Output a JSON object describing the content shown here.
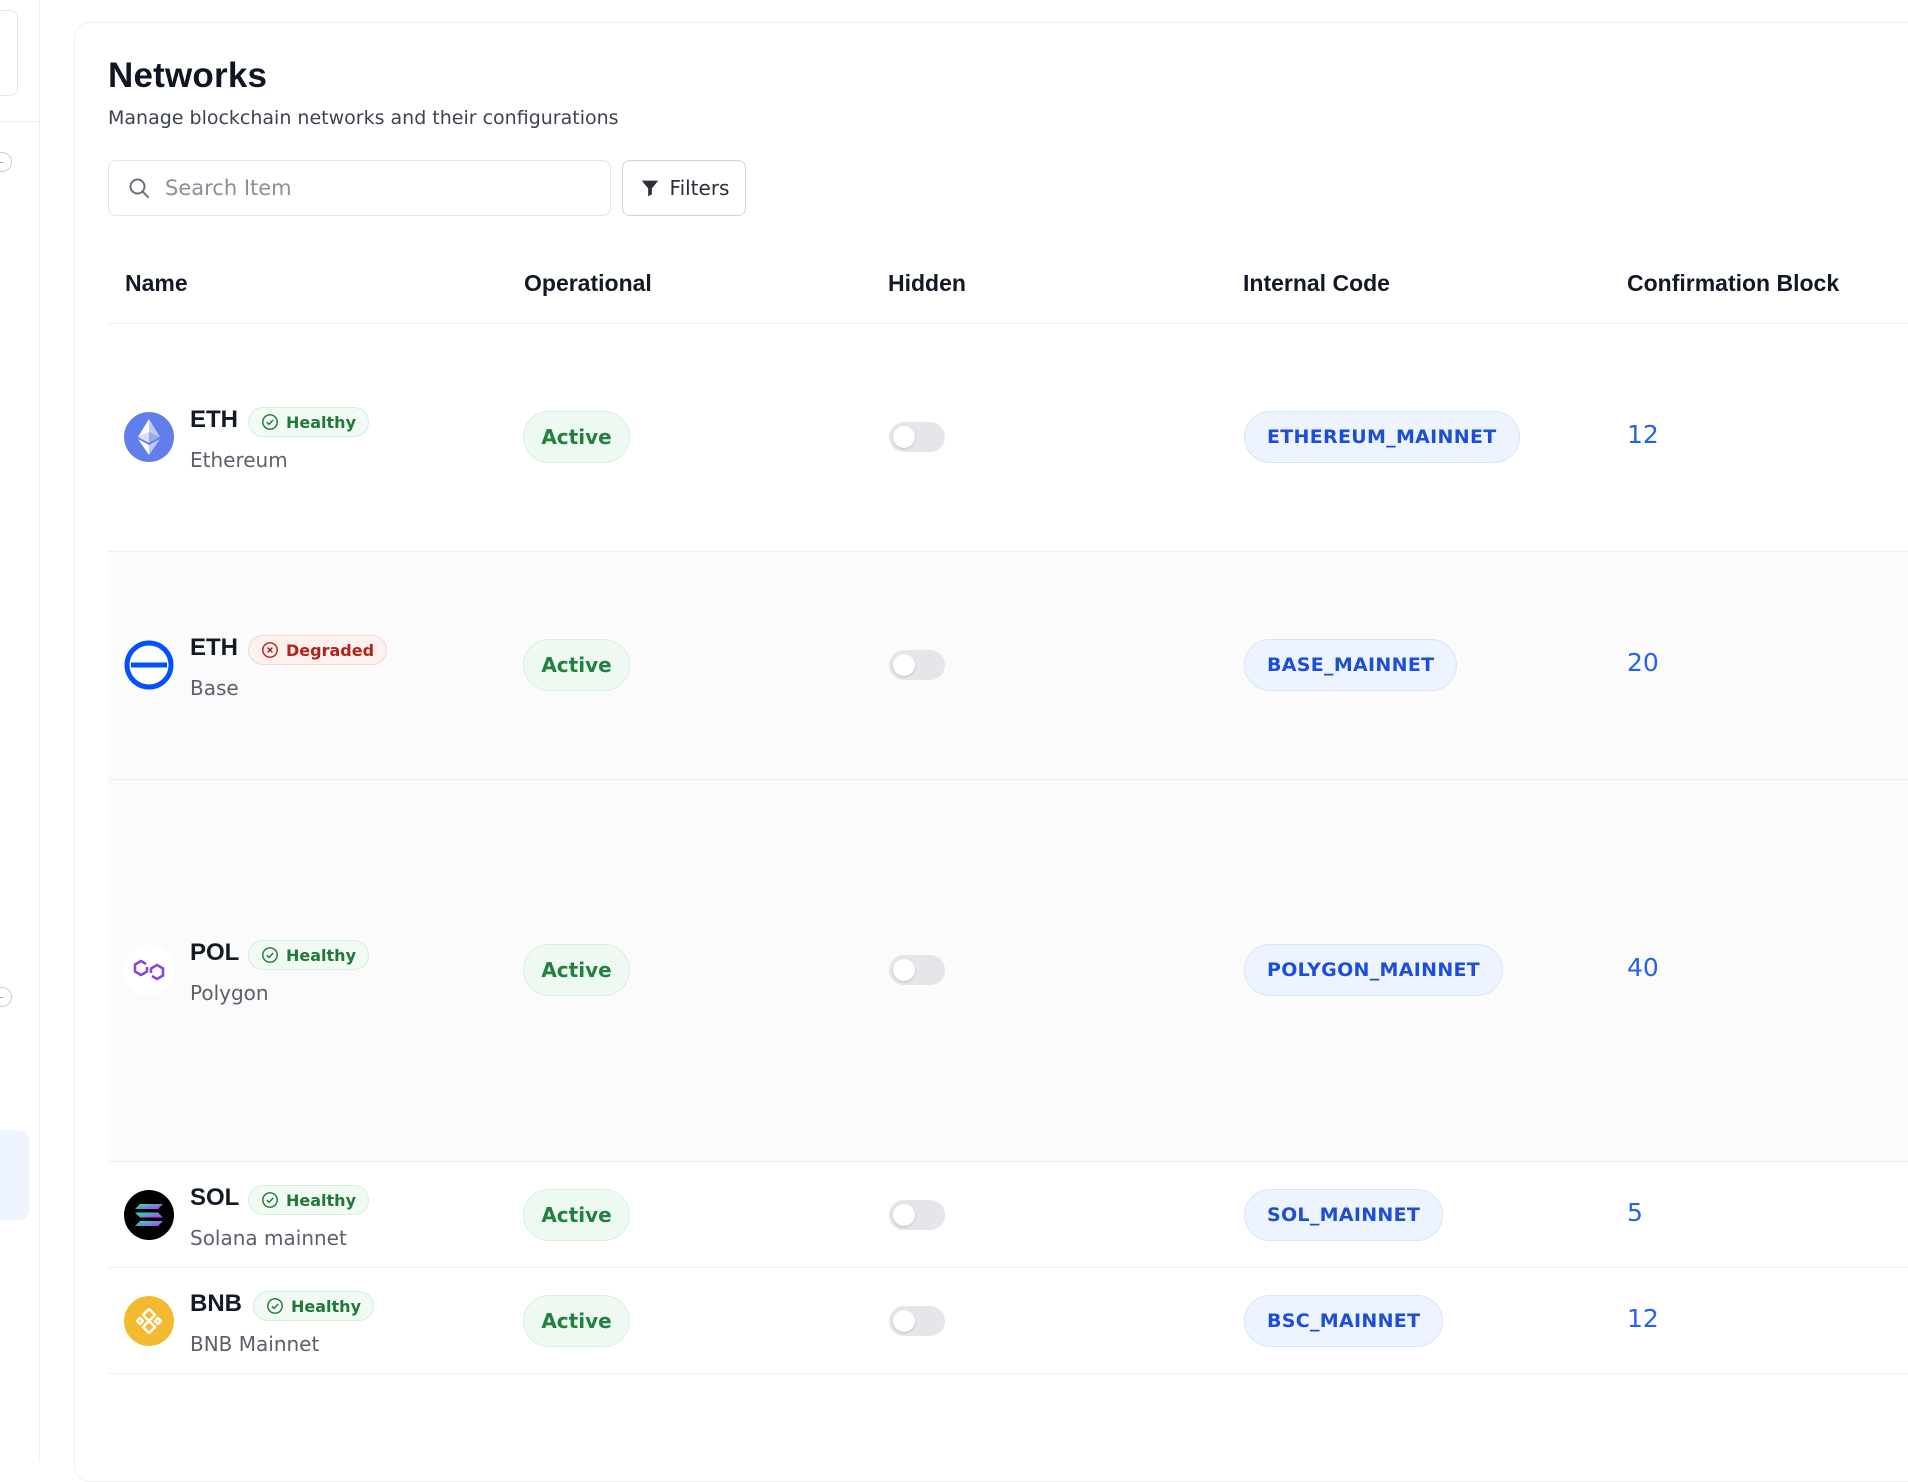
{
  "page": {
    "title": "Networks",
    "subtitle": "Manage blockchain networks and their configurations"
  },
  "search": {
    "placeholder": "Search Item",
    "value": ""
  },
  "filters": {
    "label": "Filters"
  },
  "table": {
    "columns": [
      "Name",
      "Operational",
      "Hidden",
      "Internal Code",
      "Confirmation Block"
    ],
    "rows": [
      {
        "symbol": "ETH",
        "health": "Healthy",
        "name": "Ethereum",
        "operational": "Active",
        "hidden": false,
        "code": "ETHEREUM_MAINNET",
        "confirmation": "12",
        "icon": "ethereum-icon"
      },
      {
        "symbol": "ETH",
        "health": "Degraded",
        "name": "Base",
        "operational": "Active",
        "hidden": false,
        "code": "BASE_MAINNET",
        "confirmation": "20",
        "icon": "base-icon"
      },
      {
        "symbol": "POL",
        "health": "Healthy",
        "name": "Polygon",
        "operational": "Active",
        "hidden": false,
        "code": "POLYGON_MAINNET",
        "confirmation": "40",
        "icon": "polygon-icon"
      },
      {
        "symbol": "SOL",
        "health": "Healthy",
        "name": "Solana mainnet",
        "operational": "Active",
        "hidden": false,
        "code": "SOL_MAINNET",
        "confirmation": "5",
        "icon": "solana-icon"
      },
      {
        "symbol": "BNB",
        "health": "Healthy",
        "name": "BNB Mainnet",
        "operational": "Active",
        "hidden": false,
        "code": "BSC_MAINNET",
        "confirmation": "12",
        "icon": "bnb-icon"
      }
    ]
  },
  "colors": {
    "healthy": "#1f7a3a",
    "degraded": "#b42318",
    "active": "#22813f",
    "code": "#1d4ed8",
    "confirmation": "#2563eb"
  }
}
